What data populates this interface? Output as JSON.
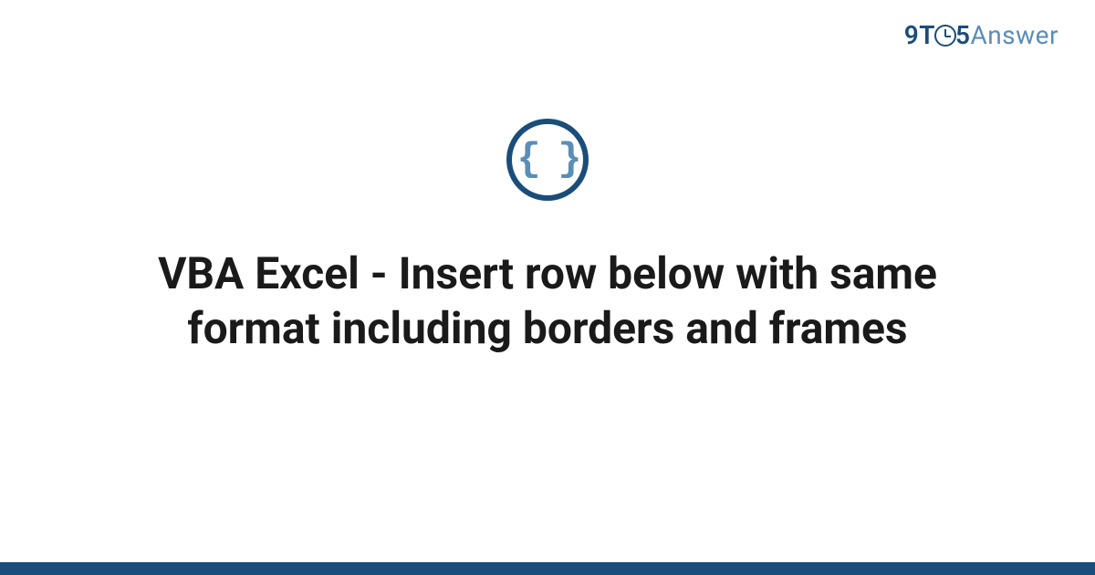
{
  "brand": {
    "part1": "9",
    "part2": "T",
    "part3": "5",
    "part4": "Answer"
  },
  "icon": {
    "braces": "{ }",
    "name": "code-braces-icon"
  },
  "title": "VBA Excel - Insert row below with same format including borders and frames",
  "colors": {
    "primary": "#1a4d7a",
    "secondary": "#5a8db8",
    "text": "#1a1a1a"
  }
}
